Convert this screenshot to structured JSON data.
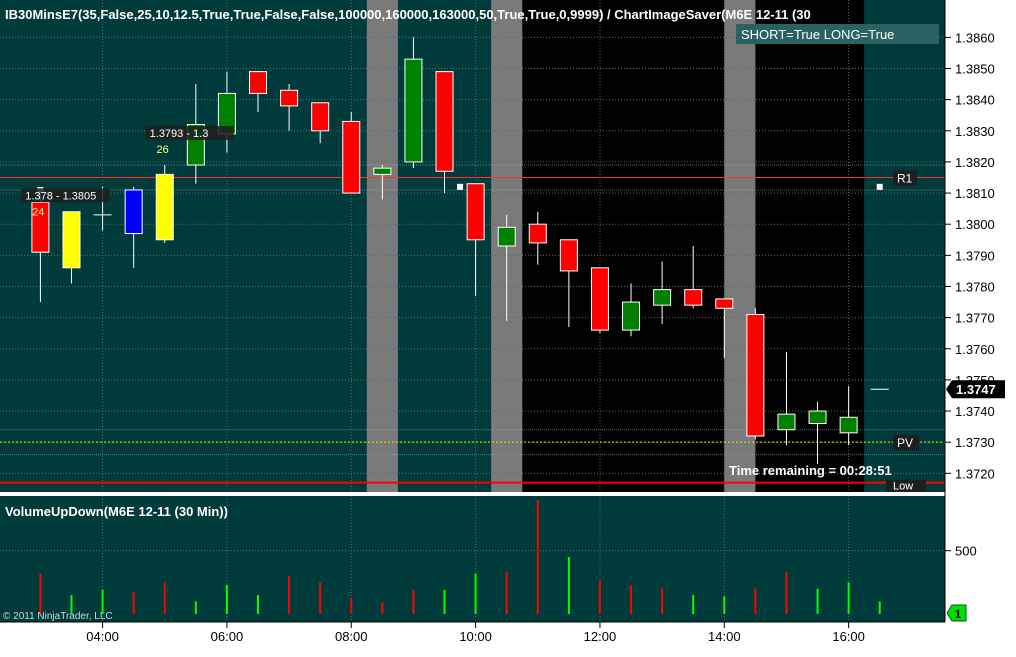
{
  "colors": {
    "background": "#003b3b",
    "session_gray": "#7a7a7a",
    "session_black": "#000000",
    "up": "#008000",
    "down": "#ff0000",
    "blue_bar": "#0000ff",
    "yellow_bar": "#ffff00",
    "axis_text": "#ffffff",
    "r1_line": "#ff3030",
    "pv_line": "#e8e800",
    "low_line": "#ff0000",
    "vol_up": "#00ff00",
    "vol_down": "#ff0000"
  },
  "header": {
    "indicator_title": "IB30MinsE7(35,False,25,10,12.5,True,True,False,False,100000,160000,163000,50,True,True,0,9999)  /  ChartImageSaver(M6E  12-11  (30",
    "signal_box": "SHORT=True LONG=True"
  },
  "annotations": {
    "range1": "1.378 - 1.3805",
    "count1": "24",
    "range2": "1.3793 - 1.3",
    "count2": "26",
    "r1_label": "R1",
    "pv_label": "PV",
    "low_label": "Low",
    "time_remaining": "Time remaining = 00:28:51",
    "last_price": "1.3747"
  },
  "lower_panel": {
    "title": "VolumeUpDown(M6E 12-11 (30 Min))",
    "copyright": "© 2011 NinjaTrader, LLC",
    "panel_badge": "1"
  },
  "chart_data": [
    {
      "type": "candlestick",
      "title": "IB30MinsE7(35,False,25,10,12.5,True,True,False,False,100000,160000,163000,50,True,True,0,9999)  /  ChartImageSaver(M6E  12-11  (30",
      "ylim": [
        1.3714,
        1.3872
      ],
      "y_ticks": [
        "1.3860",
        "1.3850",
        "1.3840",
        "1.3830",
        "1.3820",
        "1.3810",
        "1.3800",
        "1.3790",
        "1.3780",
        "1.3770",
        "1.3760",
        "1.3750",
        "1.3740",
        "1.3730",
        "1.3720"
      ],
      "x_ticks": [
        {
          "t": 4,
          "label": "04:00"
        },
        {
          "t": 6,
          "label": "06:00"
        },
        {
          "t": 8,
          "label": "08:00"
        },
        {
          "t": 10,
          "label": "10:00"
        },
        {
          "t": 12,
          "label": "12:00"
        },
        {
          "t": 14,
          "label": "14:00"
        },
        {
          "t": 16,
          "label": "16:00"
        }
      ],
      "xlim": [
        2.35,
        17.55
      ],
      "grid": true,
      "gray_sessions": [
        [
          8.25,
          8.75
        ],
        [
          10.25,
          10.75
        ],
        [
          14.0,
          14.5
        ]
      ],
      "black_sessions": [
        [
          10.75,
          14.0
        ],
        [
          14.5,
          16.25
        ]
      ],
      "candles": [
        {
          "t": 3.0,
          "o": 1.3791,
          "h": 1.3811,
          "l": 1.3775,
          "c": 1.3807,
          "color": "down"
        },
        {
          "t": 3.5,
          "o": 1.3786,
          "h": 1.3804,
          "l": 1.3781,
          "c": 1.3804,
          "color": "yellow"
        },
        {
          "t": 4.0,
          "o": 1.3804,
          "h": 1.3812,
          "l": 1.3798,
          "c": 1.3803,
          "color": "doji"
        },
        {
          "t": 4.5,
          "o": 1.3797,
          "h": 1.3812,
          "l": 1.3786,
          "c": 1.3811,
          "color": "blue"
        },
        {
          "t": 5.0,
          "o": 1.3795,
          "h": 1.3819,
          "l": 1.3794,
          "c": 1.3816,
          "color": "yellow"
        },
        {
          "t": 5.5,
          "o": 1.3819,
          "h": 1.3845,
          "l": 1.3813,
          "c": 1.3832,
          "color": "up"
        },
        {
          "t": 6.0,
          "o": 1.3829,
          "h": 1.3849,
          "l": 1.3823,
          "c": 1.3842,
          "color": "up"
        },
        {
          "t": 6.5,
          "o": 1.3849,
          "h": 1.3849,
          "l": 1.3836,
          "c": 1.3842,
          "color": "down"
        },
        {
          "t": 7.0,
          "o": 1.3843,
          "h": 1.3845,
          "l": 1.383,
          "c": 1.3838,
          "color": "down"
        },
        {
          "t": 7.5,
          "o": 1.3839,
          "h": 1.3839,
          "l": 1.3826,
          "c": 1.383,
          "color": "down"
        },
        {
          "t": 8.0,
          "o": 1.3833,
          "h": 1.3836,
          "l": 1.381,
          "c": 1.381,
          "color": "down"
        },
        {
          "t": 8.5,
          "o": 1.3816,
          "h": 1.3819,
          "l": 1.3808,
          "c": 1.3818,
          "color": "up"
        },
        {
          "t": 9.0,
          "o": 1.382,
          "h": 1.386,
          "l": 1.3818,
          "c": 1.3853,
          "color": "up"
        },
        {
          "t": 9.5,
          "o": 1.3849,
          "h": 1.3849,
          "l": 1.381,
          "c": 1.3817,
          "color": "down"
        },
        {
          "t": 10.0,
          "o": 1.3813,
          "h": 1.3813,
          "l": 1.3777,
          "c": 1.3795,
          "color": "down"
        },
        {
          "t": 10.5,
          "o": 1.3793,
          "h": 1.3803,
          "l": 1.3769,
          "c": 1.3799,
          "color": "up"
        },
        {
          "t": 11.0,
          "o": 1.38,
          "h": 1.3804,
          "l": 1.3787,
          "c": 1.3794,
          "color": "down"
        },
        {
          "t": 11.5,
          "o": 1.3795,
          "h": 1.3795,
          "l": 1.3767,
          "c": 1.3785,
          "color": "down"
        },
        {
          "t": 12.0,
          "o": 1.3786,
          "h": 1.3786,
          "l": 1.3765,
          "c": 1.3766,
          "color": "down"
        },
        {
          "t": 12.5,
          "o": 1.3766,
          "h": 1.3781,
          "l": 1.3764,
          "c": 1.3775,
          "color": "up"
        },
        {
          "t": 13.0,
          "o": 1.3774,
          "h": 1.3788,
          "l": 1.3768,
          "c": 1.3779,
          "color": "up"
        },
        {
          "t": 13.5,
          "o": 1.3779,
          "h": 1.3793,
          "l": 1.3773,
          "c": 1.3774,
          "color": "down"
        },
        {
          "t": 14.0,
          "o": 1.3776,
          "h": 1.3776,
          "l": 1.3757,
          "c": 1.3773,
          "color": "down"
        },
        {
          "t": 14.5,
          "o": 1.3771,
          "h": 1.3773,
          "l": 1.3731,
          "c": 1.3732,
          "color": "down"
        },
        {
          "t": 15.0,
          "o": 1.3734,
          "h": 1.3759,
          "l": 1.3729,
          "c": 1.3739,
          "color": "up"
        },
        {
          "t": 15.5,
          "o": 1.3736,
          "h": 1.3743,
          "l": 1.3723,
          "c": 1.374,
          "color": "up"
        },
        {
          "t": 16.0,
          "o": 1.3733,
          "h": 1.3748,
          "l": 1.3729,
          "c": 1.3738,
          "color": "up"
        }
      ],
      "ib_markers": [
        {
          "t": 3.0,
          "price": 1.3811
        },
        {
          "t": 9.75,
          "price": 1.3812
        },
        {
          "t": 16.5,
          "price": 1.3812
        }
      ],
      "last_price_tick": {
        "t": 16.5,
        "price": 1.3747
      },
      "levels": [
        {
          "name": "R1",
          "price": 1.3815,
          "color": "r1_line",
          "label": "R1",
          "style": "solid"
        },
        {
          "name": "PV",
          "price": 1.373,
          "color": "pv_line",
          "label": "PV",
          "style": "dotted"
        },
        {
          "name": "Low",
          "price": 1.3717,
          "color": "low_line",
          "label": "Low",
          "style": "solid"
        }
      ],
      "minor_levels": [
        1.3819,
        1.3811,
        1.3734,
        1.3726
      ],
      "range_labels": [
        {
          "t": 2.95,
          "price": 1.3808,
          "text_key": "range1",
          "count_key": "count1"
        },
        {
          "t": 4.95,
          "price": 1.3828,
          "text_key": "range2",
          "count_key": "count2"
        }
      ]
    },
    {
      "type": "bar",
      "title": "VolumeUpDown(M6E 12-11 (30 Min))",
      "ylim": [
        0,
        900
      ],
      "y_ticks": [
        500
      ],
      "bars": [
        {
          "t": 3.0,
          "v": 320,
          "dir": "down"
        },
        {
          "t": 3.5,
          "v": 150,
          "dir": "up"
        },
        {
          "t": 4.0,
          "v": 190,
          "dir": "up"
        },
        {
          "t": 4.5,
          "v": 170,
          "dir": "down"
        },
        {
          "t": 5.0,
          "v": 250,
          "dir": "down"
        },
        {
          "t": 5.5,
          "v": 100,
          "dir": "up"
        },
        {
          "t": 6.0,
          "v": 230,
          "dir": "up"
        },
        {
          "t": 6.5,
          "v": 150,
          "dir": "up"
        },
        {
          "t": 7.0,
          "v": 300,
          "dir": "down"
        },
        {
          "t": 7.5,
          "v": 250,
          "dir": "down"
        },
        {
          "t": 8.0,
          "v": 120,
          "dir": "down"
        },
        {
          "t": 8.5,
          "v": 90,
          "dir": "down"
        },
        {
          "t": 9.0,
          "v": 190,
          "dir": "down"
        },
        {
          "t": 9.5,
          "v": 190,
          "dir": "up"
        },
        {
          "t": 10.0,
          "v": 320,
          "dir": "up"
        },
        {
          "t": 10.5,
          "v": 330,
          "dir": "down"
        },
        {
          "t": 11.0,
          "v": 900,
          "dir": "down"
        },
        {
          "t": 11.5,
          "v": 450,
          "dir": "up"
        },
        {
          "t": 12.0,
          "v": 270,
          "dir": "down"
        },
        {
          "t": 12.5,
          "v": 230,
          "dir": "down"
        },
        {
          "t": 13.0,
          "v": 200,
          "dir": "down"
        },
        {
          "t": 13.5,
          "v": 150,
          "dir": "up"
        },
        {
          "t": 14.0,
          "v": 140,
          "dir": "up"
        },
        {
          "t": 14.5,
          "v": 200,
          "dir": "down"
        },
        {
          "t": 15.0,
          "v": 330,
          "dir": "down"
        },
        {
          "t": 15.5,
          "v": 200,
          "dir": "up"
        },
        {
          "t": 16.0,
          "v": 250,
          "dir": "up"
        },
        {
          "t": 16.5,
          "v": 100,
          "dir": "up"
        }
      ]
    }
  ]
}
